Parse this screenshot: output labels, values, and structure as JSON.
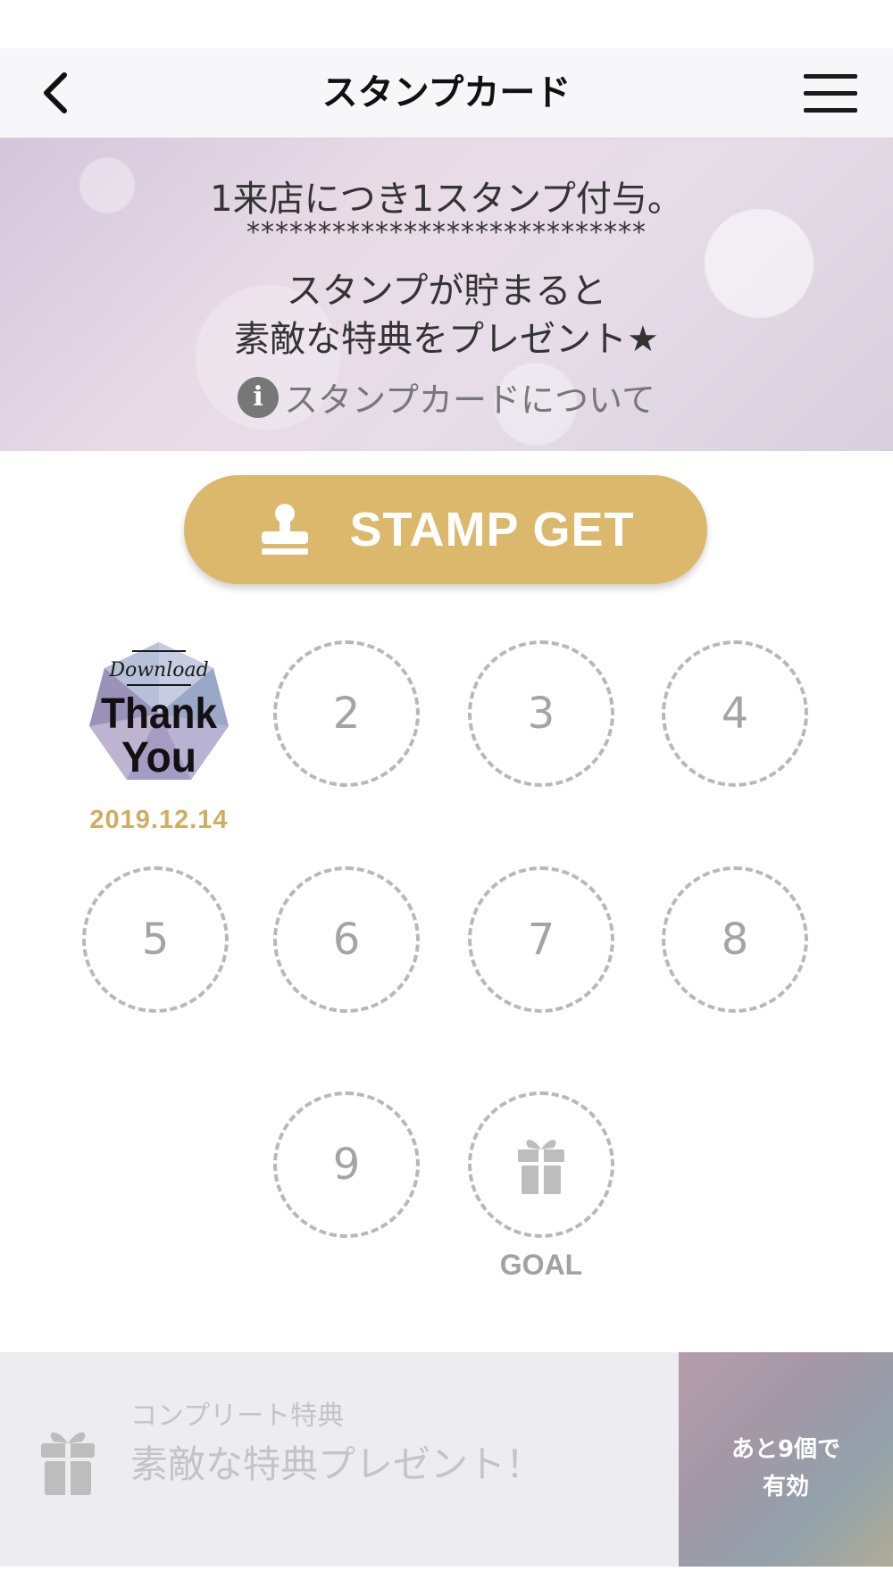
{
  "header": {
    "title": "スタンプカード"
  },
  "banner": {
    "line1": "1来店につき1スタンプ付与。",
    "stars": "****************************",
    "line2": "スタンプが貯まると",
    "line3": "素敵な特典をプレゼント★",
    "about_link": "スタンプカードについて"
  },
  "stamp_button": {
    "label": "STAMP GET"
  },
  "stamp_card": {
    "stamped": {
      "badge_top": "Download",
      "badge_line1": "Thank",
      "badge_line2": "You",
      "date": "2019.12.14"
    },
    "slots": [
      "2",
      "3",
      "4",
      "5",
      "6",
      "7",
      "8",
      "9"
    ],
    "goal_label": "GOAL"
  },
  "complete_reward": {
    "caption": "コンプリート特典",
    "title": "素敵な特典プレゼント！",
    "badge_line1": "あと9個で",
    "badge_line2": "有効"
  },
  "colors": {
    "accent": "#dcb86c",
    "date": "#cfae63",
    "slot_border": "#b8b8b8"
  }
}
